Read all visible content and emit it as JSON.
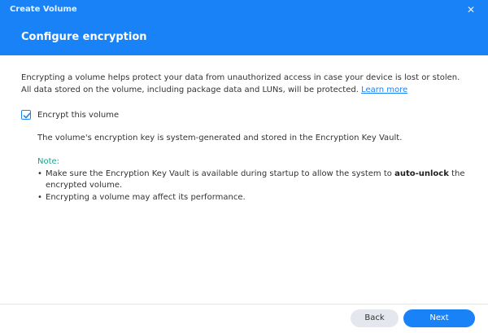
{
  "window": {
    "title": "Create Volume",
    "close_glyph": "✕"
  },
  "header": {
    "page_title": "Configure encryption"
  },
  "content": {
    "intro_text": "Encrypting a volume helps protect your data from unauthorized access in case your device is lost or stolen. All data stored on the volume, including package data and LUNs, will be protected.",
    "learn_more_label": "Learn more",
    "encrypt_checkbox": {
      "label": "Encrypt this volume",
      "checked": true
    },
    "key_description": "The volume's encryption key is system-generated and stored in the Encryption Key Vault.",
    "note": {
      "title": "Note:",
      "bullet_glyph": "•",
      "item1_prefix": "Make sure the Encryption Key Vault is available during startup to allow the system to",
      "item1_bold": "auto-unlock",
      "item1_suffix": "the encrypted volume.",
      "item2": "Encrypting a volume may affect its performance."
    }
  },
  "footer": {
    "back_label": "Back",
    "next_label": "Next"
  },
  "colors": {
    "accent": "#1a82f7",
    "note_green": "#19a48a",
    "back_button_bg": "#e4e8ee"
  },
  "icons": {
    "close": "close-icon",
    "checkbox": "checkmark-icon"
  }
}
